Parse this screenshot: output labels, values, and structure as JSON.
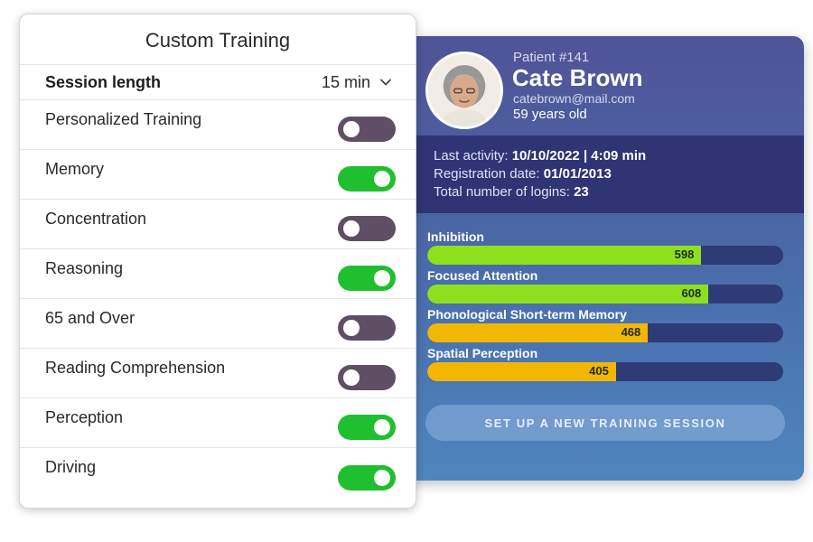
{
  "training_panel": {
    "title": "Custom Training",
    "session": {
      "label": "Session length",
      "value": "15 min"
    },
    "toggles": [
      {
        "label": "Personalized Training",
        "on": false
      },
      {
        "label": "Memory",
        "on": true
      },
      {
        "label": "Concentration",
        "on": false
      },
      {
        "label": "Reasoning",
        "on": true
      },
      {
        "label": "65 and Over",
        "on": false
      },
      {
        "label": "Reading Comprehension",
        "on": false
      },
      {
        "label": "Perception",
        "on": true
      },
      {
        "label": "Driving",
        "on": true
      }
    ]
  },
  "patient": {
    "id": "Patient #141",
    "name": "Cate Brown",
    "email": "catebrown@mail.com",
    "age": "59 years old",
    "activity": {
      "last_activity_label": "Last activity:",
      "last_activity_value": "10/10/2022 | 4:09 min",
      "registration_label": "Registration date:",
      "registration_value": "01/01/2013",
      "logins_label": "Total number of logins:",
      "logins_value": "23"
    },
    "metrics": [
      {
        "label": "Inhibition",
        "value": "598",
        "fill_fraction": 0.77,
        "color": "#8ee01e"
      },
      {
        "label": "Focused Attention",
        "value": "608",
        "fill_fraction": 0.79,
        "color": "#8ee01e"
      },
      {
        "label": "Phonological Short-term Memory",
        "value": "468",
        "fill_fraction": 0.62,
        "color": "#f2b705"
      },
      {
        "label": "Spatial Perception",
        "value": "405",
        "fill_fraction": 0.53,
        "color": "#f2b705"
      }
    ],
    "setup_button": "SET UP A NEW TRAINING SESSION"
  },
  "colors": {
    "toggle_on": "#1fbf2f",
    "toggle_off": "#5f4f64",
    "card_dark": "#2f3574"
  }
}
